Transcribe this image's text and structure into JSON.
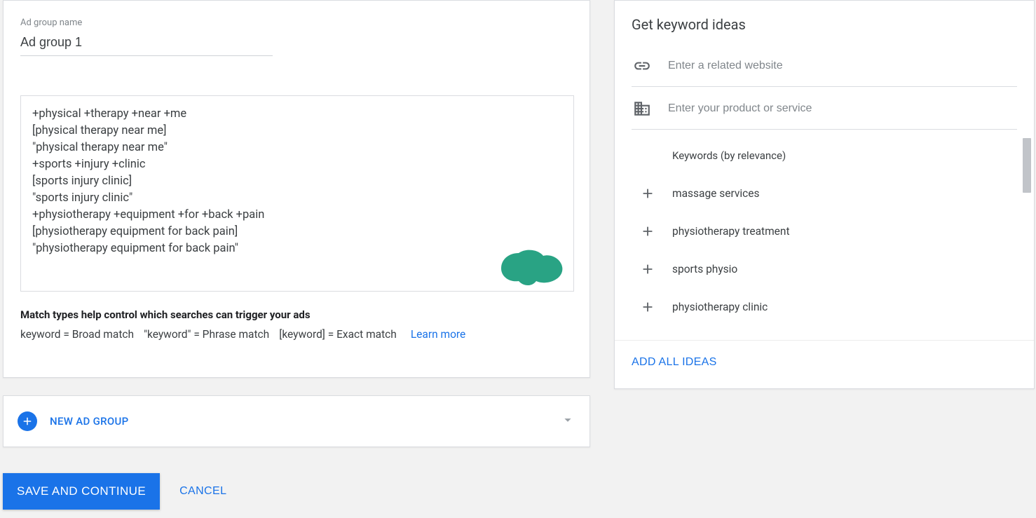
{
  "adgroup": {
    "name_label": "Ad group name",
    "name_value": "Ad group 1",
    "keywords_text": "+physical +therapy +near +me\n[physical therapy near me]\n\"physical therapy near me\"\n+sports +injury +clinic\n[sports injury clinic]\n\"sports injury clinic\"\n+physiotherapy +equipment +for +back +pain\n[physiotherapy equipment for back pain]\n\"physiotherapy equipment for back pain\"",
    "match_heading": "Match types help control which searches can trigger your ads",
    "match_broad": "keyword = Broad match",
    "match_phrase": "\"keyword\" = Phrase match",
    "match_exact": "[keyword] = Exact match",
    "learn_more": "Learn more"
  },
  "newadgroup": {
    "label": "NEW AD GROUP"
  },
  "footer": {
    "save": "SAVE AND CONTINUE",
    "cancel": "CANCEL"
  },
  "ideas": {
    "title": "Get keyword ideas",
    "website_placeholder": "Enter a related website",
    "product_placeholder": "Enter your product or service",
    "list_header": "Keywords (by relevance)",
    "items": [
      "massage services",
      "physiotherapy treatment",
      "sports physio",
      "physiotherapy clinic"
    ],
    "add_all": "ADD ALL IDEAS"
  }
}
